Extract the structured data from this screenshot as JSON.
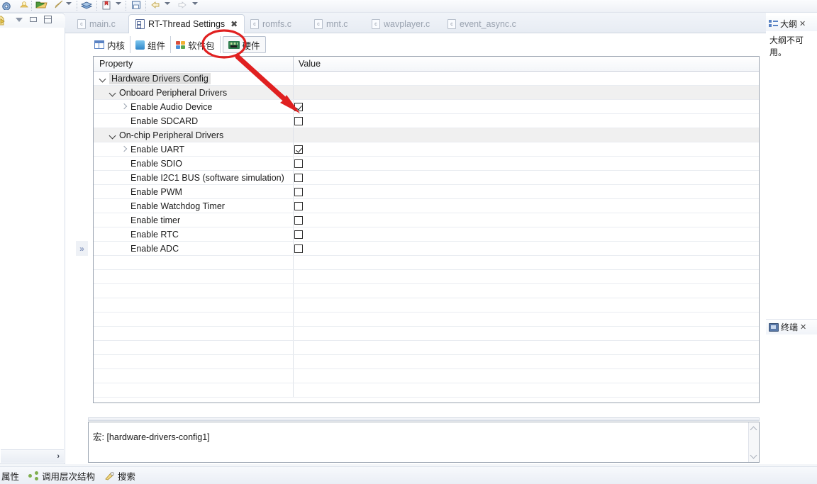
{
  "window": {
    "minimize_label": "minimize",
    "maximize_label": "maximize"
  },
  "toolbar": {
    "items": [
      {
        "name": "settings-icon"
      },
      {
        "name": "build-icon"
      },
      {
        "name": "open-folder-icon"
      },
      {
        "name": "brush-icon"
      },
      {
        "name": "brush-dropdown-icon"
      },
      {
        "name": "book-icon"
      },
      {
        "name": "bookmark-icon"
      },
      {
        "name": "bookmark-dropdown-icon"
      },
      {
        "name": "save-icon"
      },
      {
        "name": "back-icon"
      },
      {
        "name": "back-dropdown-icon"
      },
      {
        "name": "forward-icon"
      },
      {
        "name": "forward-dropdown-icon"
      }
    ]
  },
  "left_panel": {
    "view_menu_label": "view-menu",
    "minimize_label": "minimize",
    "maximize_label": "maximize",
    "more_label": "›"
  },
  "editor_tabs": [
    {
      "label": "main.c",
      "icon": "c-file-icon",
      "active": false,
      "closable": false
    },
    {
      "label": "RT-Thread Settings",
      "icon": "rt-settings-icon",
      "active": true,
      "closable": true
    },
    {
      "label": "romfs.c",
      "icon": "c-file-icon",
      "active": false,
      "closable": false
    },
    {
      "label": "mnt.c",
      "icon": "c-file-icon",
      "active": false,
      "closable": false
    },
    {
      "label": "wavplayer.c",
      "icon": "c-file-icon",
      "active": false,
      "closable": false
    },
    {
      "label": "event_async.c",
      "icon": "c-file-icon",
      "active": false,
      "closable": false
    }
  ],
  "inner_tabs": [
    {
      "label": "内核",
      "icon": "kernel-icon",
      "selected": false
    },
    {
      "label": "组件",
      "icon": "components-icon",
      "selected": false
    },
    {
      "label": "软件包",
      "icon": "packages-icon",
      "selected": false
    },
    {
      "label": "硬件",
      "icon": "hardware-icon",
      "selected": true
    }
  ],
  "table": {
    "columns": [
      "Property",
      "Value"
    ],
    "rows": [
      {
        "label": "Hardware Drivers Config",
        "indent": 0,
        "twisty": "down",
        "highlight": true,
        "value": null,
        "group": false
      },
      {
        "label": "Onboard Peripheral Drivers",
        "indent": 1,
        "twisty": "down",
        "highlight": false,
        "value": null,
        "group": true
      },
      {
        "label": "Enable Audio Device",
        "indent": 2,
        "twisty": "right",
        "highlight": false,
        "value": "checked",
        "group": false
      },
      {
        "label": "Enable SDCARD",
        "indent": 2,
        "twisty": "none",
        "highlight": false,
        "value": "unchecked",
        "group": false
      },
      {
        "label": "On-chip Peripheral Drivers",
        "indent": 1,
        "twisty": "down",
        "highlight": false,
        "value": null,
        "group": true
      },
      {
        "label": "Enable UART",
        "indent": 2,
        "twisty": "right",
        "highlight": false,
        "value": "checked",
        "group": false
      },
      {
        "label": "Enable SDIO",
        "indent": 2,
        "twisty": "none",
        "highlight": false,
        "value": "unchecked",
        "group": false
      },
      {
        "label": "Enable I2C1 BUS (software simulation)",
        "indent": 2,
        "twisty": "none",
        "highlight": false,
        "value": "unchecked",
        "group": false
      },
      {
        "label": "Enable PWM",
        "indent": 2,
        "twisty": "none",
        "highlight": false,
        "value": "unchecked",
        "group": false
      },
      {
        "label": "Enable Watchdog Timer",
        "indent": 2,
        "twisty": "none",
        "highlight": false,
        "value": "unchecked",
        "group": false
      },
      {
        "label": "Enable timer",
        "indent": 2,
        "twisty": "none",
        "highlight": false,
        "value": "unchecked",
        "group": false
      },
      {
        "label": "Enable RTC",
        "indent": 2,
        "twisty": "none",
        "highlight": false,
        "value": "unchecked",
        "group": false
      },
      {
        "label": "Enable ADC",
        "indent": 2,
        "twisty": "none",
        "highlight": false,
        "value": "unchecked",
        "group": false
      },
      {
        "label": "",
        "indent": 0,
        "twisty": "none",
        "highlight": false,
        "value": null,
        "group": false
      },
      {
        "label": "",
        "indent": 0,
        "twisty": "none",
        "highlight": false,
        "value": null,
        "group": false
      },
      {
        "label": "",
        "indent": 0,
        "twisty": "none",
        "highlight": false,
        "value": null,
        "group": false
      },
      {
        "label": "",
        "indent": 0,
        "twisty": "none",
        "highlight": false,
        "value": null,
        "group": false
      },
      {
        "label": "",
        "indent": 0,
        "twisty": "none",
        "highlight": false,
        "value": null,
        "group": false
      },
      {
        "label": "",
        "indent": 0,
        "twisty": "none",
        "highlight": false,
        "value": null,
        "group": false
      },
      {
        "label": "",
        "indent": 0,
        "twisty": "none",
        "highlight": false,
        "value": null,
        "group": false
      },
      {
        "label": "",
        "indent": 0,
        "twisty": "none",
        "highlight": false,
        "value": null,
        "group": false
      },
      {
        "label": "",
        "indent": 0,
        "twisty": "none",
        "highlight": false,
        "value": null,
        "group": false
      },
      {
        "label": "",
        "indent": 0,
        "twisty": "none",
        "highlight": false,
        "value": null,
        "group": false
      }
    ]
  },
  "description": {
    "text": "宏: [hardware-drivers-config1]"
  },
  "expand_control": {
    "label": "»"
  },
  "right_dock": {
    "outline": {
      "title": "大纲",
      "close_label": "✕",
      "body": "大纲不可用。"
    },
    "terminal": {
      "title": "终端",
      "close_label": "✕"
    }
  },
  "bottom_tabs": [
    {
      "label": "属性",
      "icon": "properties-icon"
    },
    {
      "label": "调用层次结构",
      "icon": "call-hierarchy-icon"
    },
    {
      "label": "搜索",
      "icon": "search-icon"
    }
  ],
  "annotation": {
    "color": "#e02020",
    "circle_target": "hardware-tab",
    "arrow_target": "enable-audio-device-checkbox"
  }
}
